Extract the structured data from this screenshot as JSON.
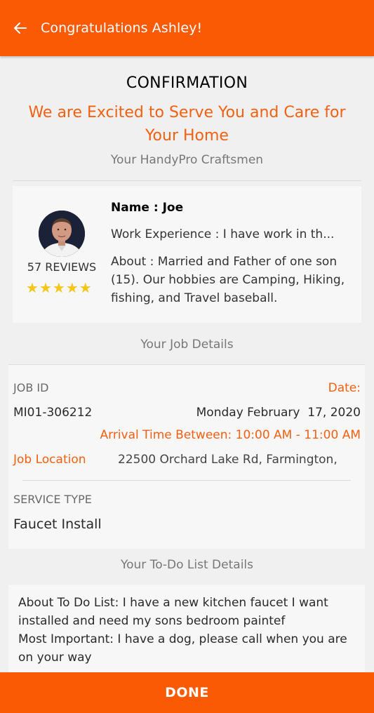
{
  "appbar": {
    "title": "Congratulations Ashley!",
    "back_icon": "arrow-left-icon"
  },
  "header": {
    "title": "CONFIRMATION",
    "tagline": "We are Excited to Serve You and Care for Your Home",
    "craftsmen_label": "Your HandyPro Craftsmen"
  },
  "craftsman": {
    "reviews": "57 REVIEWS",
    "rating": 5,
    "name": "Name : Joe",
    "experience": "Work Experience : I have work in th...",
    "about": "About : Married and Father of one son (15). Our hobbies are Camping, Hiking, fishing, and Travel baseball."
  },
  "job": {
    "section_label": "Your Job Details",
    "job_id_label": "JOB ID",
    "job_id": "MI01-306212",
    "date_label": "Date:",
    "date": "Monday February  17, 2020",
    "arrival": "Arrival Time Between: 10:00 AM - 11:00 AM",
    "location_label": "Job Location",
    "location": "22500 Orchard Lake Rd, Farmington,",
    "service_type_label": "SERVICE TYPE",
    "service_type": "Faucet Install"
  },
  "todo": {
    "section_label": "Your To-Do List Details",
    "about": "About To Do List: I have a new kitchen faucet I want installed and need my sons bedroom paintef",
    "important": "Most Important: I have a dog, please call when you are on your way"
  },
  "footer": {
    "done_label": "DONE"
  },
  "colors": {
    "brand": "#fb5a04",
    "accent_text": "#f26012",
    "star": "#f5c518"
  }
}
